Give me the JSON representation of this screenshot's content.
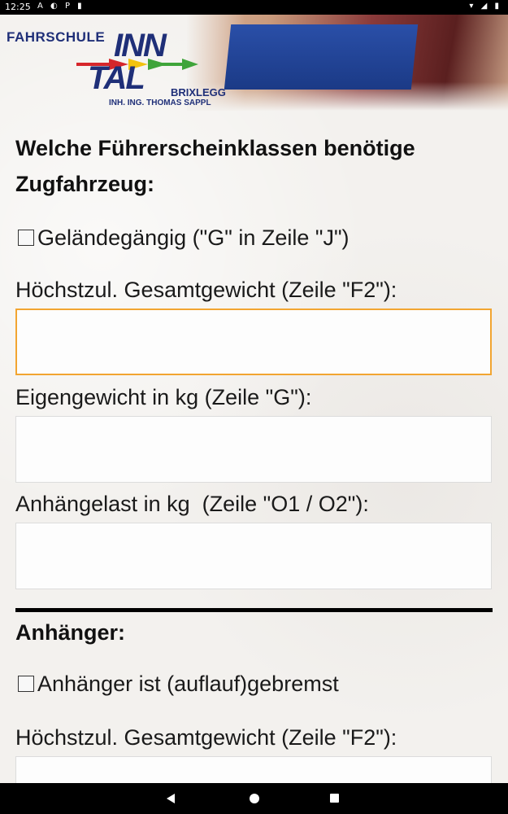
{
  "status_bar": {
    "time": "12:25",
    "left_icons": [
      "A",
      "◐",
      "P",
      "▮"
    ],
    "right_icons": [
      "▾",
      "◢",
      "▮"
    ]
  },
  "header": {
    "school_label": "FAHRSCHULE",
    "logo_line1": "INN",
    "logo_line2": "TAL",
    "location": "BRIXLEGG",
    "owner": "INH. ING. THOMAS SAPPL"
  },
  "form": {
    "section1_title_line1": "Welche Führerscheinklassen benötige",
    "section1_title_line2": "Zugfahrzeug:",
    "offroad_checkbox_label": "Geländegängig (\"G\" in Zeile \"J\")",
    "total_weight_label": "Höchstzul. Gesamtgewicht (Zeile \"F2\"):",
    "total_weight_value": "",
    "own_weight_label": "Eigengewicht in kg (Zeile \"G\"):",
    "own_weight_value": "",
    "towing_load_label": "Anhängelast in kg  (Zeile \"O1 / O2\"):",
    "towing_load_value": "",
    "trailer_title": "Anhänger:",
    "trailer_braked_label": "Anhänger ist (auflauf)gebremst",
    "trailer_total_weight_label": "Höchstzul. Gesamtgewicht (Zeile \"F2\"):",
    "trailer_total_weight_value": ""
  },
  "colors": {
    "focus_border": "#f2a531",
    "logo_blue": "#1f2f78"
  }
}
